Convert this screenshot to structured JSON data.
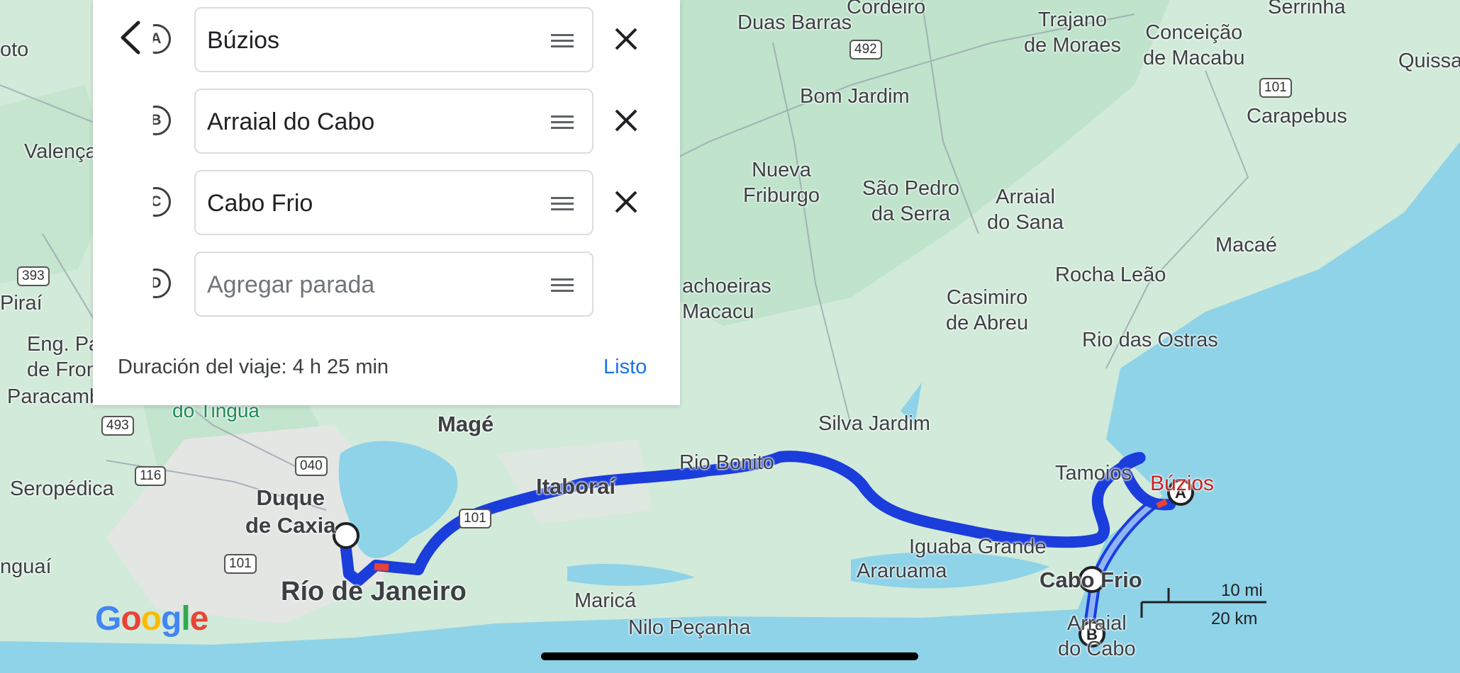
{
  "panel": {
    "stops": [
      {
        "marker": "A",
        "value": "Búzios",
        "placeholder": ""
      },
      {
        "marker": "B",
        "value": "Arraial do Cabo",
        "placeholder": ""
      },
      {
        "marker": "C",
        "value": "Cabo Frio",
        "placeholder": ""
      },
      {
        "marker": "D",
        "value": "",
        "placeholder": "Agregar parada"
      }
    ],
    "duration": "Duración del viaje: 4 h 25 min",
    "done_label": "Listo"
  },
  "map": {
    "labels": {
      "duas_barras": "Duas Barras",
      "cordeiro": "Cordeiro",
      "trajano": "Trajano\nde Moraes",
      "conceicao": "Conceição\nde Macabu",
      "serrinha": "Serrinha",
      "quissama": "Quissar",
      "bom_jardim": "Bom Jardim",
      "carapebus": "Carapebus",
      "valenca": "Valença",
      "nova_friburgo": "Nueva\nFriburgo",
      "sao_pedro": "São Pedro\nda Serra",
      "arraial_sana": "Arraial\ndo Sana",
      "macae": "Macaé",
      "cachoeiras": "achoeiras\nMacacu",
      "rocha_leao": "Rocha Leão",
      "pirai": "Piraí",
      "casimiro": "Casimiro\nde Abreu",
      "rio_das_ostras": "Rio das Ostras",
      "eng_paulo": "Eng. Pau\nde Fron",
      "paracambi": "Paracamb",
      "tingua": "do Tinguá",
      "mage": "Magé",
      "silva_jardim": "Silva Jardim",
      "rio_bonito": "Rio Bonito",
      "itaborai": "Itaboraí",
      "tamoios": "Tamoios",
      "buzios": "Búzios",
      "seropedica": "Seropédica",
      "duque": "Duque\nde Caxia",
      "iguaba": "Iguaba Grande",
      "araruama": "Araruama",
      "cabo_frio": "Cabo Frio",
      "rio": "Río de Janeiro",
      "marica": "Maricá",
      "nilo": "Nilo Peçanha",
      "arraial_cabo": "Arraial\ndo Cabo",
      "itaguai": "nguaí",
      "oto": "oto"
    },
    "shields": {
      "r492": "492",
      "r101a": "101",
      "r393": "393",
      "r493": "493",
      "r040": "040",
      "r116": "116",
      "r101b": "101",
      "r101c": "101"
    },
    "route_markers": {
      "a": "A",
      "b": "B"
    },
    "scale": {
      "mi": "10 mi",
      "km": "20 km"
    },
    "logo": "Google",
    "colors": {
      "water": "#8fd3e8",
      "land": "#cfe8dc",
      "route": "#1a3ddb",
      "route_alt": "#8fb4f5",
      "traffic": "#ea4335"
    }
  }
}
